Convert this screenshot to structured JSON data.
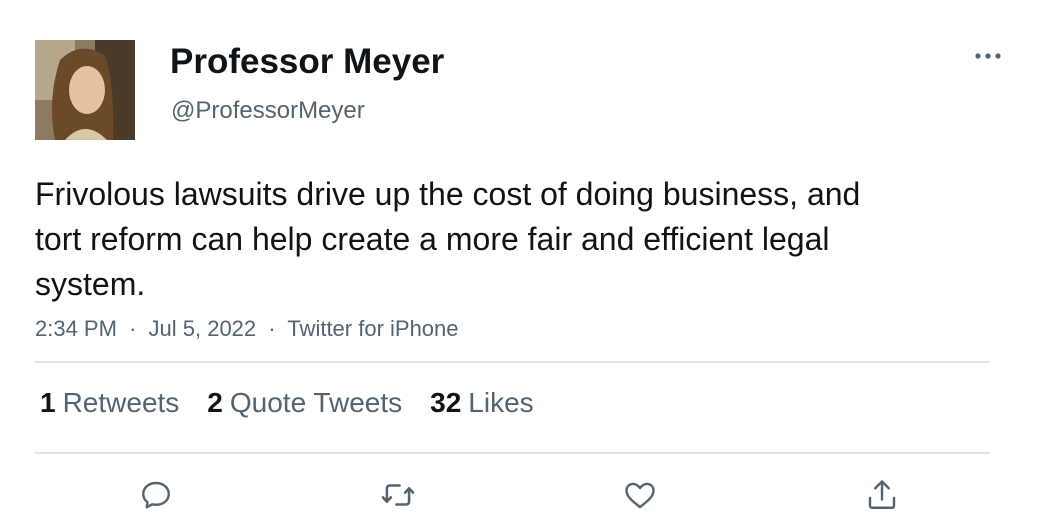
{
  "author": {
    "name": "Professor Meyer",
    "handle": "@ProfessorMeyer"
  },
  "tweet": {
    "text": "Frivolous lawsuits drive up the cost of doing business, and tort reform can help create a more fair and efficient legal system.",
    "time": "2:34 PM",
    "date": "Jul 5, 2022",
    "source": "Twitter for iPhone",
    "separator": "·"
  },
  "stats": {
    "retweets": {
      "count": "1",
      "label": "Retweets"
    },
    "quote_tweets": {
      "count": "2",
      "label": "Quote Tweets"
    },
    "likes": {
      "count": "32",
      "label": "Likes"
    }
  },
  "icons": {
    "more": "more-horizontal-icon",
    "reply": "reply-icon",
    "retweet": "retweet-icon",
    "like": "heart-icon",
    "share": "share-icon"
  },
  "colors": {
    "text_primary": "#0f1419",
    "text_secondary": "#536471",
    "divider": "#dfe3e6"
  }
}
